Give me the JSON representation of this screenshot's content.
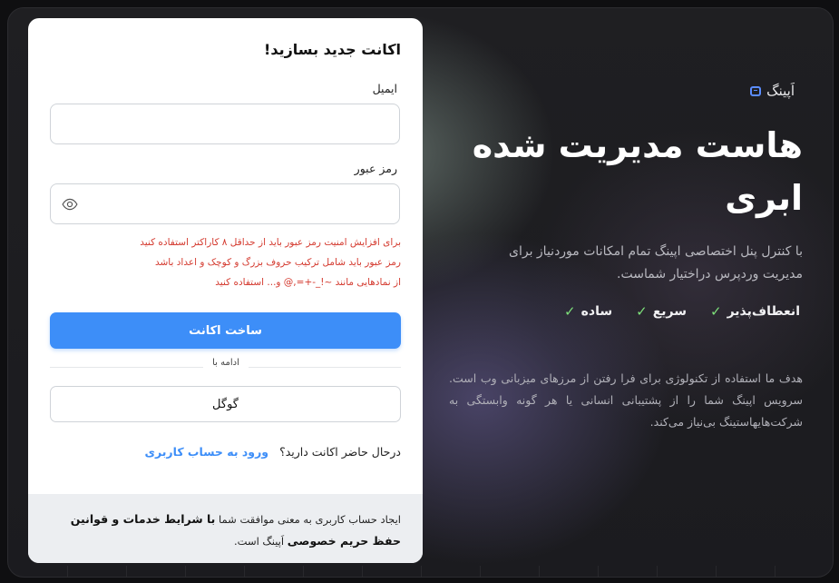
{
  "brand": {
    "name": "اَپینگ",
    "icon": "server-icon",
    "accent": "#5b8dff"
  },
  "hero": {
    "title": "هاست مدیریت شده ابری",
    "subtitle": "با کنترل پنل اختصاصی اپینگ تمام امکانات موردنیاز برای مدیریت وردپرس دراختیار شماست.",
    "features": [
      "انعطاف‌پذیر",
      "سریع",
      "ساده"
    ],
    "description": "هدف ما استفاده از تکنولوژی برای فرا رفتن از مرزهای میزبانی وب است. سرویس اپینگ شما را از پشتیبانی انسانی یا هر گونه وابستگی به شرکت‌هایهاستینگ بی‌نیاز می‌کند."
  },
  "form": {
    "title": "اکانت جدید بسازید!",
    "email_label": "ایمیل",
    "password_label": "رمز عبور",
    "password_hints": [
      "برای افزایش امنیت رمز عبور باید از حداقل ۸ کاراکتر استفاده کنید",
      "رمز عبور باید شامل ترکیب حروف بزرگ و کوچک و اعداد باشد",
      "از نمادهایی مانند ~!_-+=,@ و... استفاده کنید"
    ],
    "submit_label": "ساخت اکانت",
    "divider_label": "ادامه با",
    "google_label": "گوگل",
    "login_prompt": "درحال حاضر اکانت دارید؟",
    "login_link": "ورود به حساب کاربری"
  },
  "footer": {
    "prefix": "ایجاد حساب کاربری به معنی موافقت شما",
    "terms": "با شرایط خدمات و قوانین حفظ حریم خصوصی",
    "suffix": "اَپینگ است."
  },
  "colors": {
    "primary": "#3d8ef8",
    "error": "#d43a2f",
    "check": "#7ddf7a"
  }
}
